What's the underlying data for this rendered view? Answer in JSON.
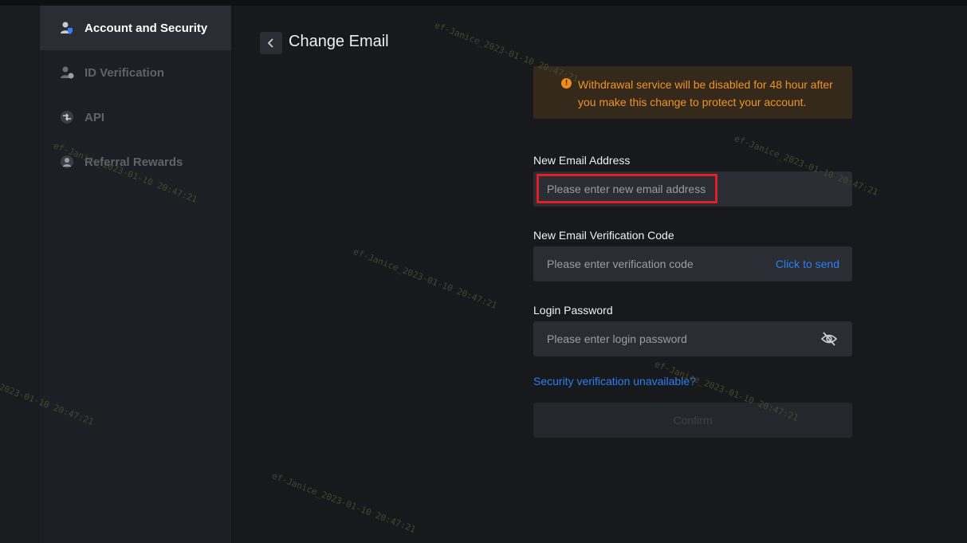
{
  "sidebar": {
    "items": [
      {
        "label": "Account and Security",
        "icon": "account-security-icon",
        "active": true
      },
      {
        "label": "ID Verification",
        "icon": "id-verification-icon",
        "active": false
      },
      {
        "label": "API",
        "icon": "api-icon",
        "active": false
      },
      {
        "label": "Referral Rewards",
        "icon": "referral-rewards-icon",
        "active": false
      }
    ]
  },
  "header": {
    "title": "Change Email"
  },
  "notice": {
    "text": "Withdrawal service will be disabled for 48 hour after you make this change to protect your account.",
    "icon": "warning-icon",
    "color": "#f0932a"
  },
  "form": {
    "new_email": {
      "label": "New Email Address",
      "placeholder": "Please enter new email address",
      "value": ""
    },
    "verification_code": {
      "label": "New Email Verification Code",
      "placeholder": "Please enter verification code",
      "value": "",
      "send_label": "Click to send"
    },
    "password": {
      "label": "Login Password",
      "placeholder": "Please enter login password",
      "value": "",
      "toggle_icon": "eye-off-icon"
    },
    "security_link": "Security verification unavailable?",
    "confirm_label": "Confirm"
  },
  "watermark": {
    "text": "ef-Janice_2023-01-10 20:47:21"
  },
  "colors": {
    "accent": "#2e7ff2",
    "highlight": "#e41e26",
    "background": "#17191d"
  }
}
